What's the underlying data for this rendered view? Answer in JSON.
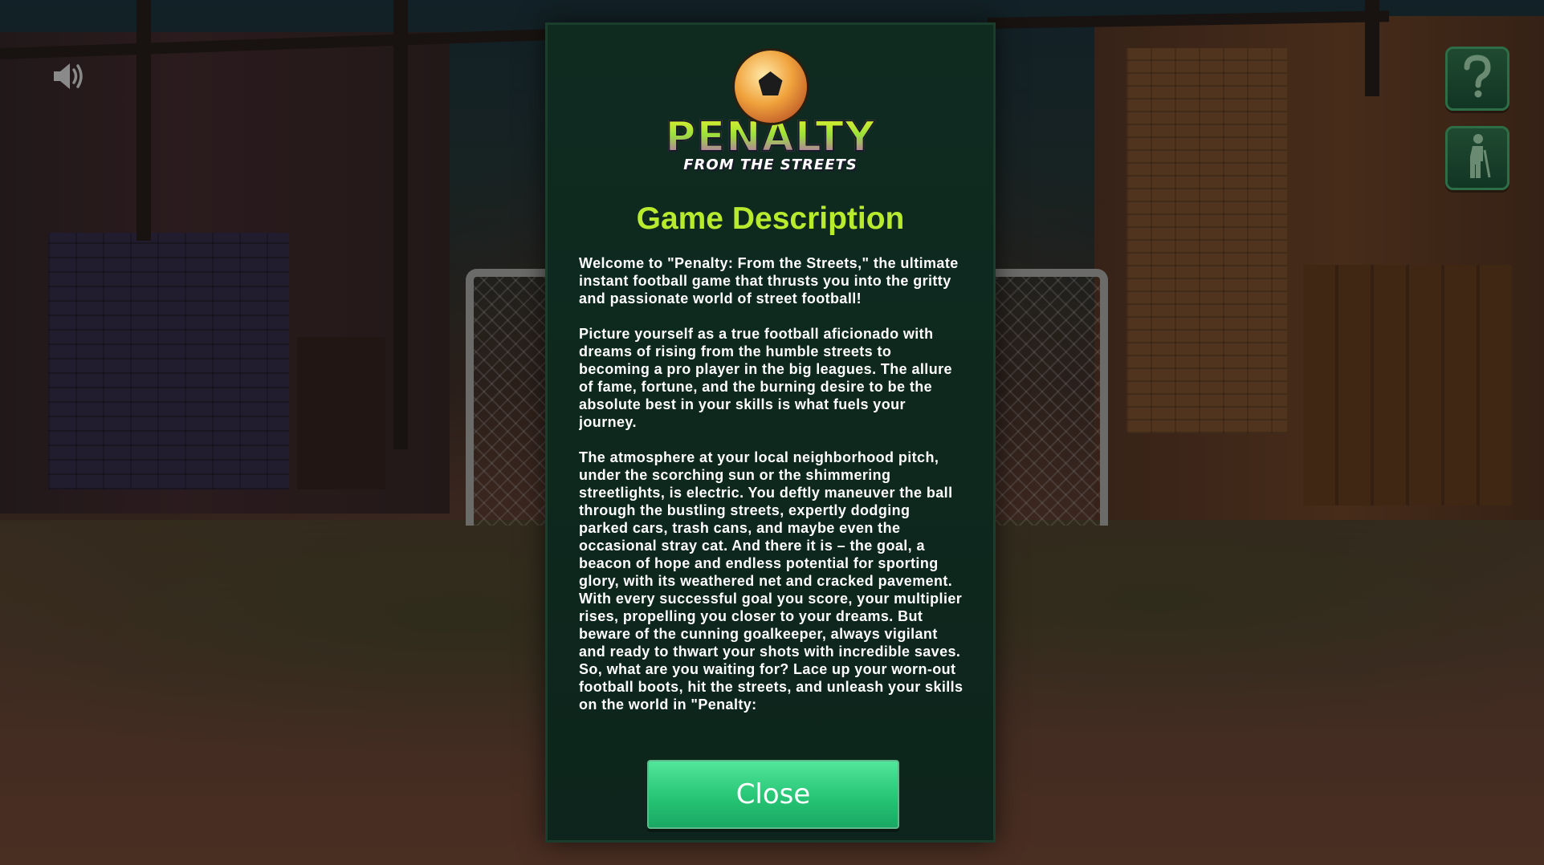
{
  "icons": {
    "sound": "speaker-icon",
    "help": "question-mark-icon",
    "exit": "walking-person-icon",
    "logo_ball": "soccer-ball-icon"
  },
  "colors": {
    "modal_bg": "#0f2b20",
    "title": "#b8ea2e",
    "close_button": "#27c575",
    "side_button": "#1f4a30"
  },
  "modal": {
    "logo": {
      "word": "PENALTY",
      "sub": "FROM THE STREETS"
    },
    "title": "Game Description",
    "paragraphs": [
      "Welcome to \"Penalty: From the Streets,\" the ultimate instant football game that thrusts you into the gritty and passionate world of street football!",
      "Picture yourself as a true football aficionado with dreams of rising from the humble streets to becoming a pro player in the big leagues. The allure of fame, fortune, and the burning desire to be the absolute best in your skills is what fuels your journey.",
      "The atmosphere at your local neighborhood pitch, under the scorching sun or the shimmering streetlights, is electric. You deftly maneuver the ball through the bustling streets, expertly dodging parked cars, trash cans, and maybe even the occasional stray cat. And there it is – the goal, a beacon of hope and endless potential for sporting glory, with its weathered net and cracked pavement.",
      "With every successful goal you score, your multiplier rises, propelling you closer to your dreams. But beware of the cunning goalkeeper, always vigilant and ready to thwart your shots with incredible saves.",
      "So, what are you waiting for? Lace up your worn-out football boots, hit the streets, and unleash your skills on the world in \"Penalty:"
    ],
    "close_label": "Close"
  }
}
